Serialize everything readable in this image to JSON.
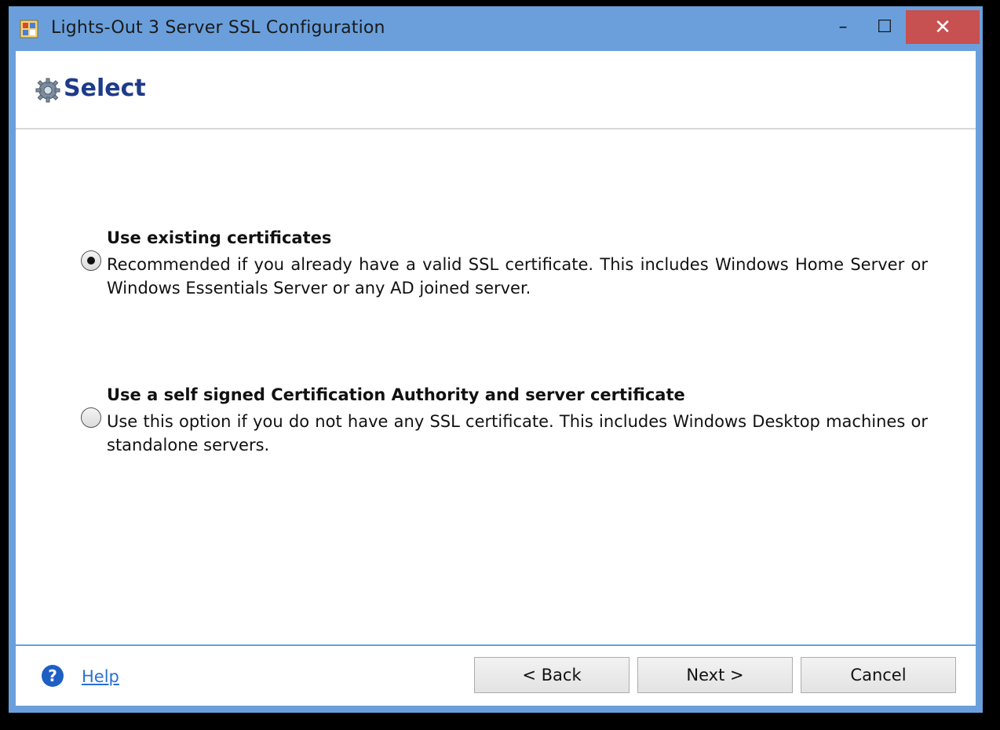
{
  "window": {
    "title": "Lights-Out 3 Server SSL Configuration",
    "controls": {
      "minimize": "–",
      "maximize": "☐",
      "close": "✕"
    },
    "title_bar_color": "#6a9fdc",
    "close_button_color": "#c75050"
  },
  "header": {
    "icon": "gear-icon",
    "title": "Select",
    "title_color": "#1e3b8a"
  },
  "options": [
    {
      "title": "Use existing certificates",
      "description": "Recommended if you already have a valid SSL certificate. This includes Windows Home Server or Windows Essentials Server or any AD joined server.",
      "selected": true
    },
    {
      "title": "Use a self signed Certification Authority and server certificate",
      "description": "Use this option if you do not have any SSL certificate. This includes Windows Desktop machines or standalone servers.",
      "selected": false
    }
  ],
  "footer": {
    "help_icon": "help-icon",
    "help_icon_glyph": "?",
    "help_label": "Help",
    "back_label": "<  Back",
    "next_label": "Next  >",
    "cancel_label": "Cancel"
  }
}
